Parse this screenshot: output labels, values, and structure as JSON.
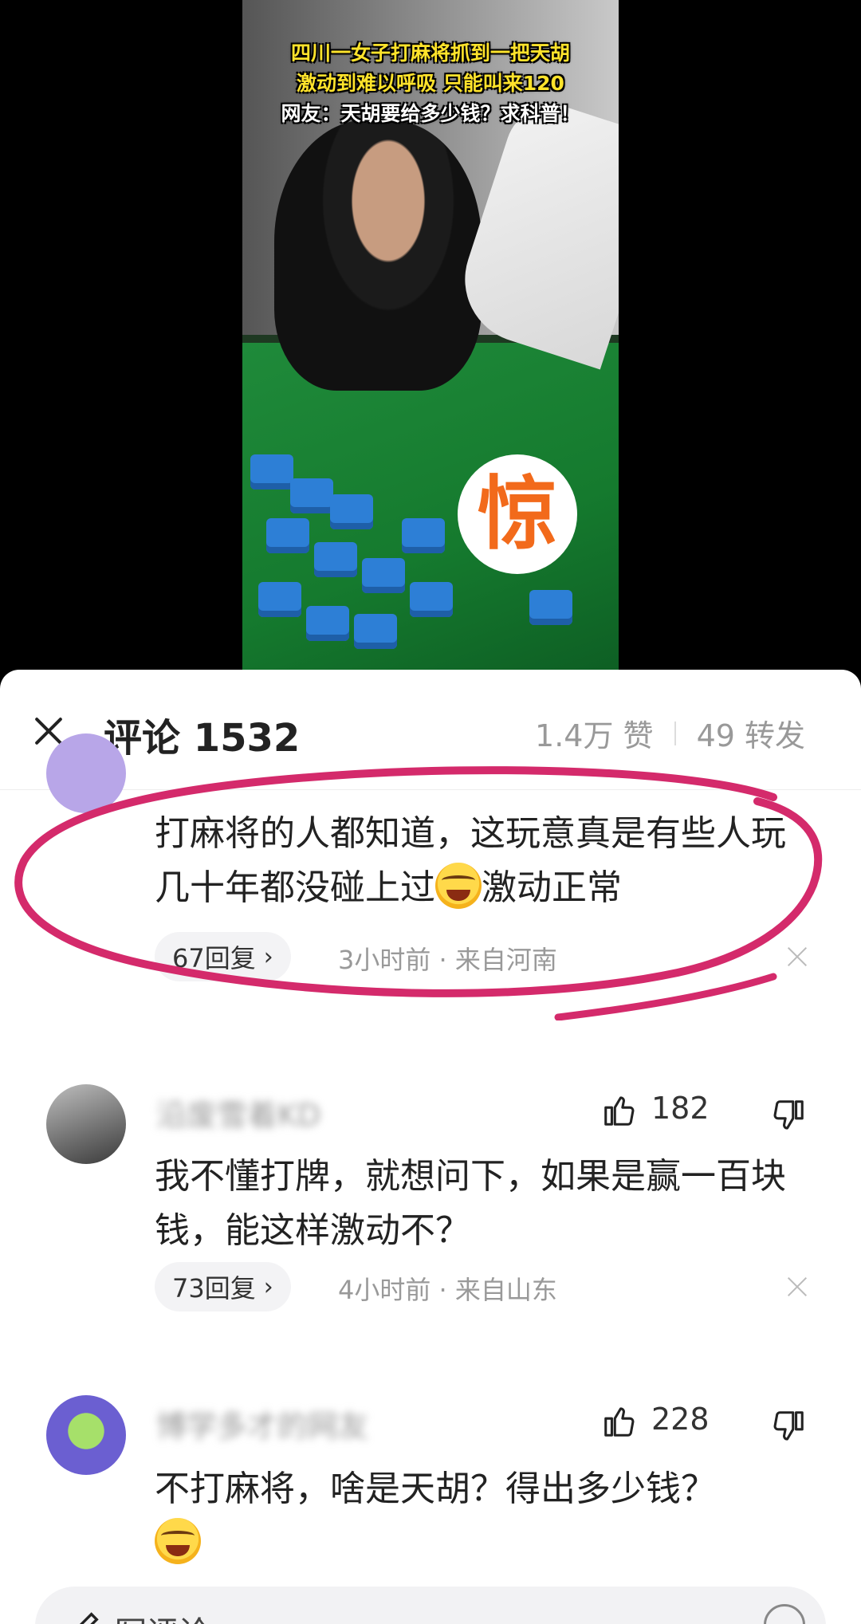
{
  "video": {
    "caption_lines": [
      "四川一女子打麻将抓到一把天胡",
      "激动到难以呼吸 只能叫来120",
      "网友：天胡要给多少钱？求科普！"
    ],
    "stamp_text": "惊"
  },
  "header": {
    "title": "评论 1532",
    "likes": "1.4万 赞",
    "shares": "49 转发"
  },
  "comments": [
    {
      "text_before_emoji": "打麻将的人都知道，这玩意真是有些人玩几十年都没碰上过",
      "text_after_emoji": "激动正常",
      "replies": "67回复",
      "meta": "3小时前 · 来自河南"
    },
    {
      "username": "沿废雪着KD",
      "likes": "182",
      "text": "我不懂打牌，就想问下，如果是赢一百块钱，能这样激动不？",
      "replies": "73回复",
      "meta": "4小时前 · 来自山东"
    },
    {
      "username": "博学多才的网友",
      "likes": "228",
      "text": "不打麻将，啥是天胡？得出多少钱？"
    }
  ],
  "input": {
    "placeholder": "写评论"
  },
  "colors": {
    "highlight_ring": "#d42a6b",
    "caption_yellow": "#ffe32b",
    "stamp_orange": "#f26a1b"
  }
}
